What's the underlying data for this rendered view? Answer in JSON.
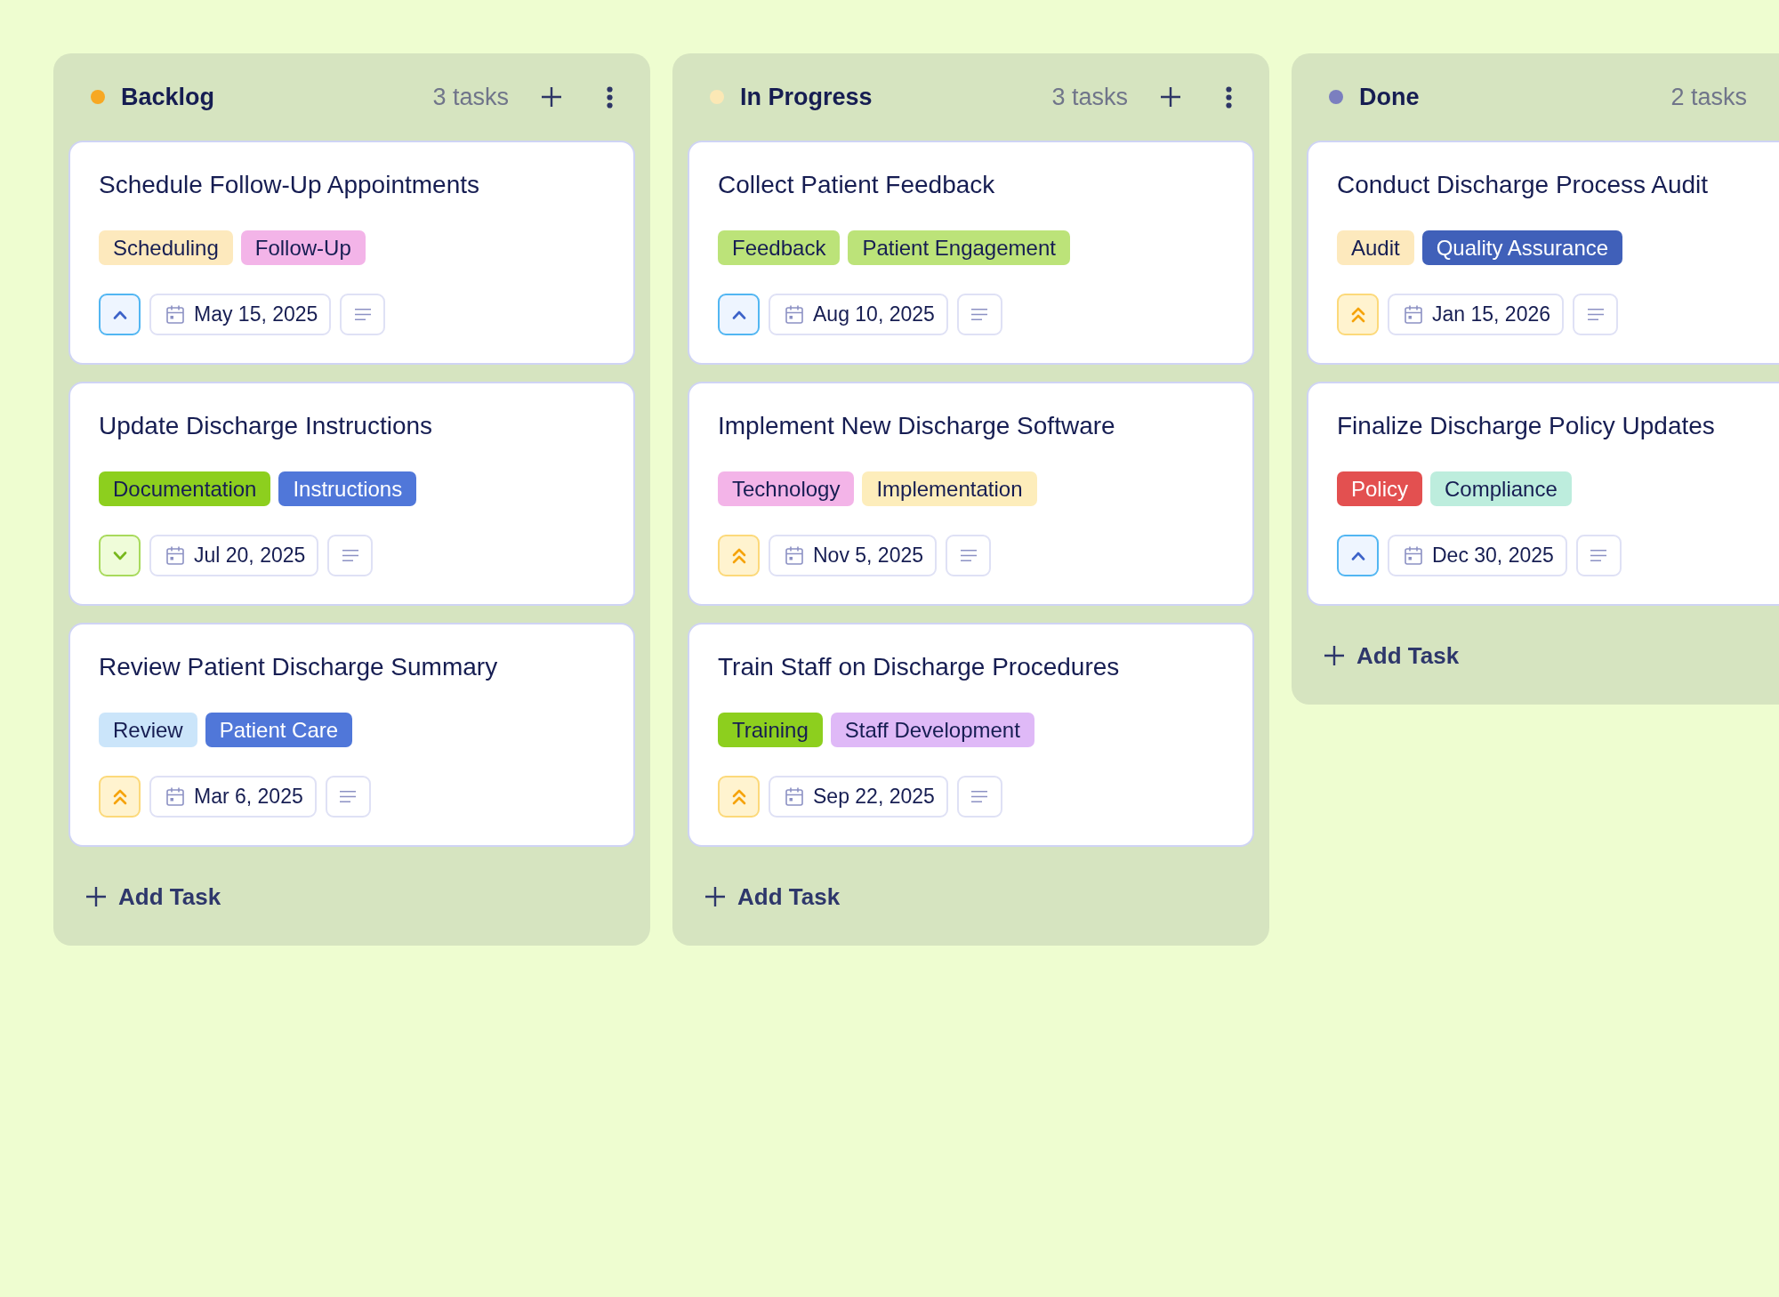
{
  "columns": [
    {
      "title": "Backlog",
      "color": "#f7a823",
      "count": "3 tasks",
      "cards": [
        {
          "title": "Schedule Follow-Up Appointments",
          "tags": [
            {
              "label": "Scheduling",
              "color": "#fde9bd"
            },
            {
              "label": "Follow-Up",
              "color": "#f3b4e8"
            }
          ],
          "priority": {
            "kind": "medium"
          },
          "due": "May 15, 2025"
        },
        {
          "title": "Update Discharge Instructions",
          "tags": [
            {
              "label": "Documentation",
              "color": "#8dcf1e"
            },
            {
              "label": "Instructions",
              "color": "#5077d9"
            }
          ],
          "priority": {
            "kind": "low"
          },
          "due": "Jul 20, 2025"
        },
        {
          "title": "Review Patient Discharge Summary",
          "tags": [
            {
              "label": "Review",
              "color": "#cbe5fa"
            },
            {
              "label": "Patient Care",
              "color": "#5077d9"
            }
          ],
          "priority": {
            "kind": "high"
          },
          "due": "Mar 6, 2025"
        }
      ],
      "add_label": "Add Task"
    },
    {
      "title": "In Progress",
      "color": "#fbe8b5",
      "count": "3 tasks",
      "cards": [
        {
          "title": "Collect Patient Feedback",
          "tags": [
            {
              "label": "Feedback",
              "color": "#bce379"
            },
            {
              "label": "Patient Engagement",
              "color": "#bce379"
            }
          ],
          "priority": {
            "kind": "medium"
          },
          "due": "Aug 10, 2025"
        },
        {
          "title": "Implement New Discharge Software",
          "tags": [
            {
              "label": "Technology",
              "color": "#f3b4e8"
            },
            {
              "label": "Implementation",
              "color": "#fdedbb"
            }
          ],
          "priority": {
            "kind": "high"
          },
          "due": "Nov 5, 2025"
        },
        {
          "title": "Train Staff on Discharge Procedures",
          "tags": [
            {
              "label": "Training",
              "color": "#8dcf1e"
            },
            {
              "label": "Staff Development",
              "color": "#dfb9f7"
            }
          ],
          "priority": {
            "kind": "high"
          },
          "due": "Sep 22, 2025"
        }
      ],
      "add_label": "Add Task"
    },
    {
      "title": "Done",
      "color": "#7b7fbf",
      "count": "2 tasks",
      "cards": [
        {
          "title": "Conduct Discharge Process Audit",
          "tags": [
            {
              "label": "Audit",
              "color": "#fde9bd"
            },
            {
              "label": "Quality Assurance",
              "color": "#4060b9"
            }
          ],
          "priority": {
            "kind": "high"
          },
          "due": "Jan 15, 2026"
        },
        {
          "title": "Finalize Discharge Policy Updates",
          "tags": [
            {
              "label": "Policy",
              "color": "#e35050"
            },
            {
              "label": "Compliance",
              "color": "#bdeddd"
            }
          ],
          "priority": {
            "kind": "medium"
          },
          "due": "Dec 30, 2025"
        }
      ],
      "add_label": "Add Task"
    }
  ]
}
